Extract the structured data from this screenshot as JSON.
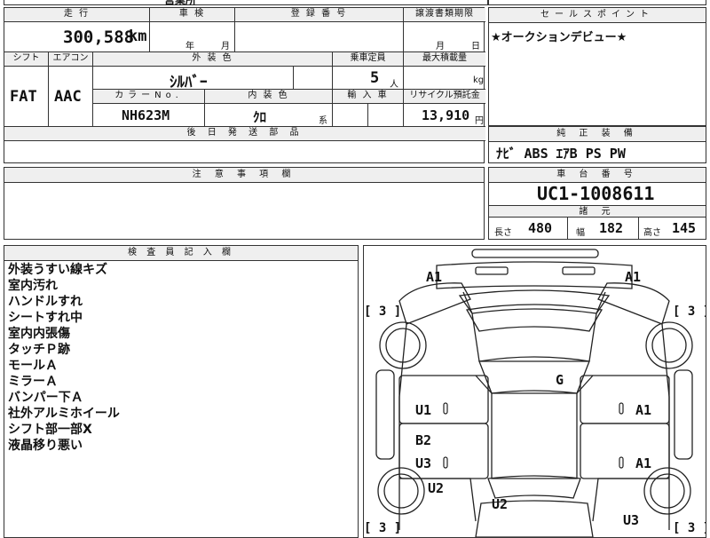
{
  "top_strip": {
    "partial_text": "営業所"
  },
  "mileage": {
    "header": "走 行",
    "value": "300,588",
    "unit": "km"
  },
  "inspection": {
    "header": "車 検",
    "year_label": "年",
    "month_label": "月"
  },
  "registration": {
    "header": "登 録 番 号",
    "value": ""
  },
  "transfer_deadline": {
    "header": "譲渡書類期限",
    "month_label": "月",
    "day_label": "日"
  },
  "sales_point": {
    "header": "セールスポイント",
    "text": "★オークションデビュー★"
  },
  "shift": {
    "header": "シフト",
    "value": "FAT"
  },
  "aircon": {
    "header": "エアコン",
    "value": "AAC"
  },
  "exterior_color": {
    "header": "外 装 色",
    "value": "ｼﾙﾊﾞｰ"
  },
  "capacity": {
    "header": "乗車定員",
    "value": "5",
    "unit": "人"
  },
  "max_load": {
    "header": "最大積載量",
    "unit": "kg"
  },
  "color_no": {
    "header": "カラーNo.",
    "value": "NH623M"
  },
  "interior_color": {
    "header": "内 装 色",
    "value": "ｸﾛ",
    "suffix": "系"
  },
  "import": {
    "header": "輸 入 車"
  },
  "recycle": {
    "header": "リサイクル預託金",
    "value": "13,910",
    "unit": "円"
  },
  "later_parts": {
    "header": "後 日 発 送 部 品"
  },
  "equipment": {
    "header": "純 正 装 備",
    "value": "ﾅﾋﾞ ABS ｴｱB PS PW"
  },
  "notes": {
    "header": "注 意 事 項 欄"
  },
  "chassis": {
    "header": "車 台 番 号",
    "value": "UC1-1008611"
  },
  "specs": {
    "header": "諸 元",
    "length_label": "長さ",
    "length": "480",
    "width_label": "幅",
    "width": "182",
    "height_label": "高さ",
    "height": "145"
  },
  "inspector": {
    "header": "検 査 員 記 入 欄",
    "remarks": [
      "外装うすい線キズ",
      "室内汚れ",
      "ハンドルすれ",
      "シートすれ中",
      "室内内張傷",
      "タッチＰ跡",
      "モールＡ",
      "ミラーＡ",
      "バンパー下Ａ",
      "社外アルミホイール",
      "シフト部一部X",
      "液晶移り悪い"
    ]
  },
  "diagram": {
    "marks": {
      "front_left": "A1",
      "front_right": "A1",
      "roof": "G",
      "left_front_door": "U1",
      "right_front_door": "A1",
      "left_rear_upper": "B2",
      "left_rear_lower": "U3",
      "right_rear_door": "A1",
      "left_rear_fender": "U2",
      "trunk": "U2",
      "right_rear_fender": "U3"
    },
    "tire_labels": {
      "front_left": "[ 3 ]",
      "front_right": "[ 3 ]",
      "rear_left": "[ 3 ]",
      "rear_right": "[ 3 ]"
    }
  }
}
